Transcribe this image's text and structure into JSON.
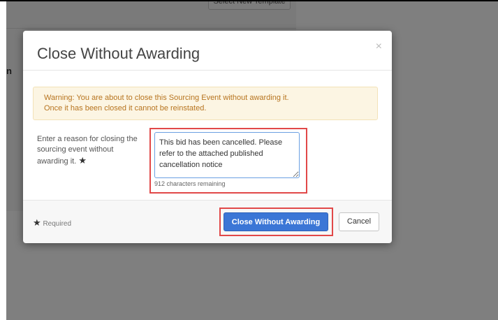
{
  "background": {
    "template_button_label": "Select New Template",
    "side_heading": "n"
  },
  "modal": {
    "title": "Close Without Awarding",
    "close_symbol": "×",
    "warning_line1": "Warning: You are about to close this Sourcing Event without awarding it.",
    "warning_line2": "Once it has been closed it cannot be reinstated.",
    "reason_label": "Enter a reason for closing the sourcing event without awarding it.",
    "required_star": "★",
    "reason_value": "This bid has been cancelled. Please refer to the attached published cancellation notice",
    "chars_remaining": "912 characters remaining",
    "required_note": "Required",
    "primary_button": "Close Without Awarding",
    "cancel_button": "Cancel"
  },
  "colors": {
    "primary": "#3b76d6",
    "highlight": "#e14848",
    "warning_bg": "#fcf5e3",
    "warning_text": "#b7741f"
  }
}
